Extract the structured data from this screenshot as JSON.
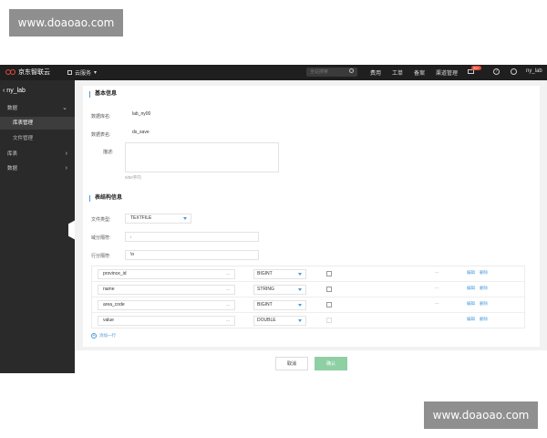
{
  "watermark": {
    "text": "www.doaoao.com"
  },
  "topbar": {
    "brand": "京东智联云",
    "service_label": "云服务",
    "search_placeholder": "全站搜索",
    "nav": [
      "费用",
      "工单",
      "备案",
      "渠道管理"
    ],
    "badge": "99+",
    "username": "ny_lab"
  },
  "sidebar": {
    "back_label": "ny_lab",
    "items": [
      {
        "label": "数据",
        "expanded": true
      },
      {
        "label": "库表管理",
        "active": true
      },
      {
        "label": "文件管理"
      },
      {
        "label": "库表"
      },
      {
        "label": "数据"
      }
    ]
  },
  "basic": {
    "section_title": "基本信息",
    "db_label": "数据库名:",
    "db_value": "lab_ny00",
    "table_label": "数据表名:",
    "table_value": "ds_save",
    "desc_label": "描述:",
    "desc_hint": "0/50字内"
  },
  "struct": {
    "section_title": "表结构信息",
    "file_type_label": "文件类型:",
    "file_type_value": "TEXTFILE",
    "field_sep_label": "域分隔符:",
    "field_sep_value": ",",
    "line_sep_label": "行分隔符:",
    "line_sep_value": "\\n",
    "columns": [
      {
        "name": "province_id",
        "type": "BIGINT",
        "edit": "编辑",
        "delete": "删除",
        "disabled": false
      },
      {
        "name": "name",
        "type": "STRING",
        "edit": "编辑",
        "delete": "删除",
        "disabled": false
      },
      {
        "name": "area_code",
        "type": "BIGINT",
        "edit": "编辑",
        "delete": "删除",
        "disabled": false
      },
      {
        "name": "value",
        "type": "DOUBLE",
        "edit": "编辑",
        "delete": "删除",
        "disabled": true
      }
    ],
    "add_row_label": "添加一行"
  },
  "footer": {
    "cancel_label": "取消",
    "ok_label": "确认"
  },
  "colors": {
    "accent": "#4a9bdc",
    "topbar": "#1f1f1f",
    "sidebar": "#2a2a2a",
    "ok_button": "#8ecfa4"
  }
}
